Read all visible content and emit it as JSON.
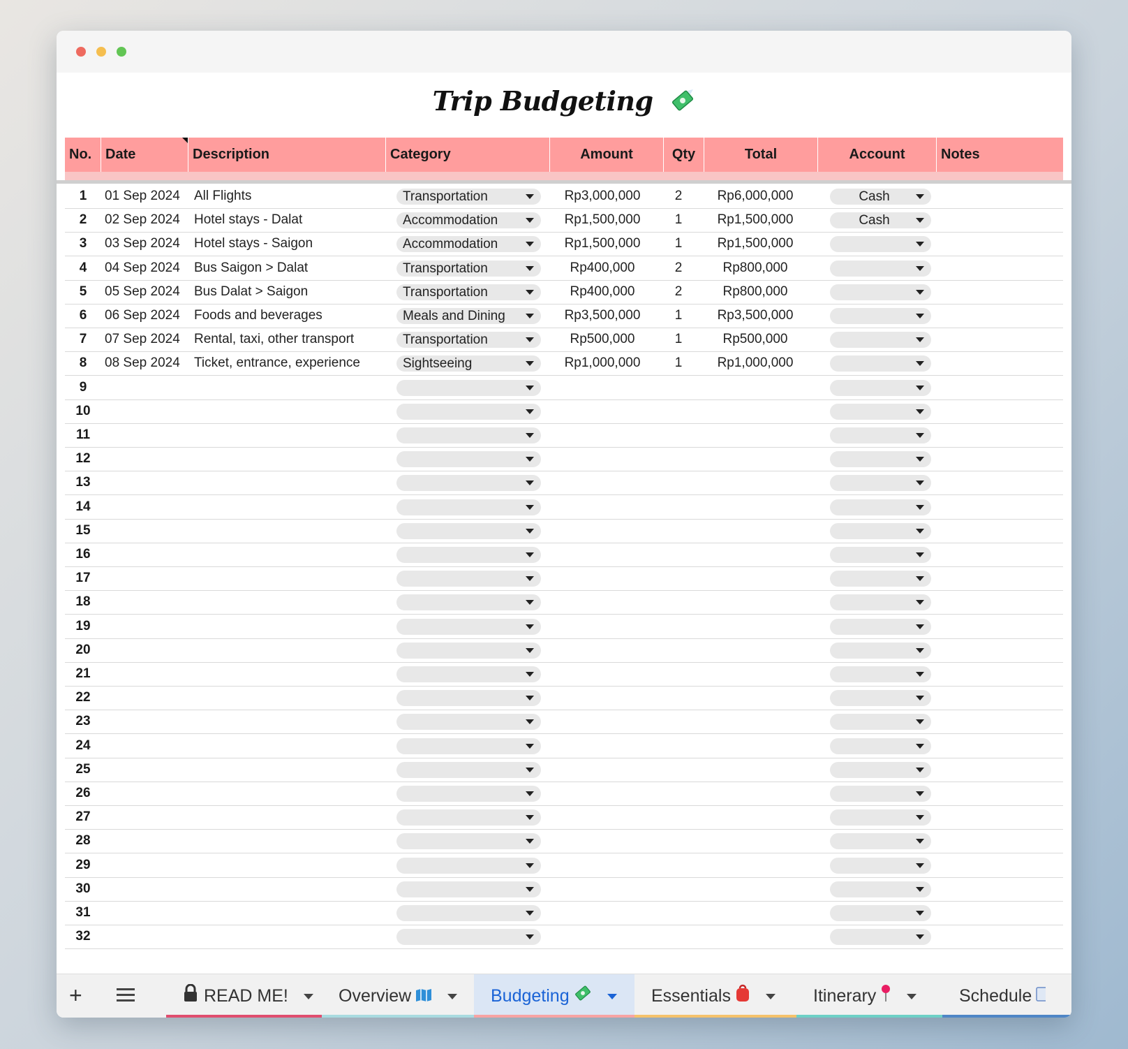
{
  "sheet": {
    "title": "Trip Budgeting",
    "title_icon": "money-with-wings-icon"
  },
  "columns": [
    "No.",
    "Date",
    "Description",
    "Category",
    "Amount",
    "Qty",
    "Total",
    "Account",
    "Notes"
  ],
  "rows": [
    {
      "no": "1",
      "date": "01 Sep 2024",
      "description": "All Flights",
      "category": "Transportation",
      "amount": "Rp3,000,000",
      "qty": "2",
      "total": "Rp6,000,000",
      "account": "Cash"
    },
    {
      "no": "2",
      "date": "02 Sep 2024",
      "description": "Hotel stays - Dalat",
      "category": "Accommodation",
      "amount": "Rp1,500,000",
      "qty": "1",
      "total": "Rp1,500,000",
      "account": "Cash"
    },
    {
      "no": "3",
      "date": "03 Sep 2024",
      "description": "Hotel stays - Saigon",
      "category": "Accommodation",
      "amount": "Rp1,500,000",
      "qty": "1",
      "total": "Rp1,500,000",
      "account": ""
    },
    {
      "no": "4",
      "date": "04 Sep 2024",
      "description": "Bus Saigon > Dalat",
      "category": "Transportation",
      "amount": "Rp400,000",
      "qty": "2",
      "total": "Rp800,000",
      "account": ""
    },
    {
      "no": "5",
      "date": "05 Sep 2024",
      "description": "Bus Dalat > Saigon",
      "category": "Transportation",
      "amount": "Rp400,000",
      "qty": "2",
      "total": "Rp800,000",
      "account": ""
    },
    {
      "no": "6",
      "date": "06 Sep 2024",
      "description": "Foods and beverages",
      "category": "Meals and Dining",
      "amount": "Rp3,500,000",
      "qty": "1",
      "total": "Rp3,500,000",
      "account": ""
    },
    {
      "no": "7",
      "date": "07 Sep 2024",
      "description": "Rental, taxi, other transport",
      "category": "Transportation",
      "amount": "Rp500,000",
      "qty": "1",
      "total": "Rp500,000",
      "account": ""
    },
    {
      "no": "8",
      "date": "08 Sep 2024",
      "description": "Ticket, entrance, experience",
      "category": "Sightseeing",
      "amount": "Rp1,000,000",
      "qty": "1",
      "total": "Rp1,000,000",
      "account": ""
    },
    {
      "no": "9"
    },
    {
      "no": "10"
    },
    {
      "no": "11"
    },
    {
      "no": "12"
    },
    {
      "no": "13"
    },
    {
      "no": "14"
    },
    {
      "no": "15"
    },
    {
      "no": "16"
    },
    {
      "no": "17"
    },
    {
      "no": "18"
    },
    {
      "no": "19"
    },
    {
      "no": "20"
    },
    {
      "no": "21"
    },
    {
      "no": "22"
    },
    {
      "no": "23"
    },
    {
      "no": "24"
    },
    {
      "no": "25"
    },
    {
      "no": "26"
    },
    {
      "no": "27"
    },
    {
      "no": "28"
    },
    {
      "no": "29"
    },
    {
      "no": "30"
    },
    {
      "no": "31"
    },
    {
      "no": "32"
    }
  ],
  "tabs": [
    {
      "label": "READ ME!",
      "icon": "lock-icon",
      "color": "#e04e6f",
      "active": false
    },
    {
      "label": "Overview",
      "icon": "map-icon",
      "color": "#a9dbe0",
      "active": false
    },
    {
      "label": "Budgeting",
      "icon": "money-with-wings-icon",
      "color": "#f7a3a3",
      "active": true
    },
    {
      "label": "Essentials",
      "icon": "backpack-icon",
      "color": "#f5c26b",
      "active": false
    },
    {
      "label": "Itinerary",
      "icon": "pin-icon",
      "color": "#6ed0c6",
      "active": false
    },
    {
      "label": "Schedule",
      "icon": "calendar-icon",
      "color": "#4f86c6",
      "active": false
    }
  ],
  "colors": {
    "header_bg": "#ff9d9d",
    "active_tab_bg": "#dbe6f5",
    "active_tab_text": "#1a63d6"
  }
}
